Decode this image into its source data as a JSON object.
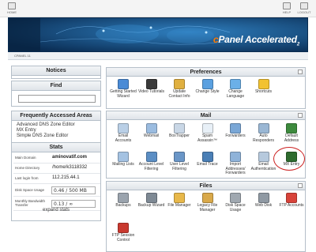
{
  "topbar": {
    "home": "HOME",
    "help": "HELP",
    "logout": "LOGOUT"
  },
  "banner": {
    "brand_prefix": "c",
    "brand_rest": "Panel Accelerated",
    "brand_sub": "2"
  },
  "breadcrumb": "CPANEL 11",
  "left": {
    "notices_title": "Notices",
    "find_title": "Find",
    "faa_title": "Frequently Accessed Areas",
    "faa_links": [
      "Advanced DNS Zone Editor",
      "MX Entry",
      "Simple DNS Zone Editor"
    ],
    "stats_title": "Stats",
    "stats": {
      "main_domain_label": "Main Domain",
      "main_domain_value": "aminovatif.com",
      "home_dir_label": "Home Directory",
      "home_dir_value": "/home/k3118332",
      "last_login_label": "Last login from",
      "last_login_value": "112.215.44.1",
      "disk_label": "Disk Space Usage",
      "disk_value": "0.46 / 500 MB",
      "bandwidth_label": "Monthly Bandwidth Transfer",
      "bandwidth_value": "0.13 / ∞"
    },
    "expand_stats": "expand stats"
  },
  "panels": {
    "preferences_title": "Preferences",
    "mail_title": "Mail",
    "files_title": "Files"
  },
  "preferences": [
    {
      "label": "Getting Started Wizard",
      "icon": "wizard-icon",
      "color": "#4a8bd6"
    },
    {
      "label": "Video Tutorials",
      "icon": "video-icon",
      "color": "#3a3a3a"
    },
    {
      "label": "Update Contact Info",
      "icon": "contact-icon",
      "color": "#e0b040"
    },
    {
      "label": "Change Style",
      "icon": "style-icon",
      "color": "#5aa0e0"
    },
    {
      "label": "Change Language",
      "icon": "language-icon",
      "color": "#6bb0e8"
    },
    {
      "label": "Shortcuts",
      "icon": "star-icon",
      "color": "#f2c230"
    }
  ],
  "mail": [
    {
      "label": "Email Accounts",
      "icon": "envelope-icon",
      "color": "#b9cfe6"
    },
    {
      "label": "Webmail",
      "icon": "webmail-icon",
      "color": "#9bbce0"
    },
    {
      "label": "BoxTrapper",
      "icon": "boxtrapper-icon",
      "color": "#c9d7e6"
    },
    {
      "label": "Spam Assassin™",
      "icon": "spamassassin-icon",
      "color": "#e8f0f7"
    },
    {
      "label": "Forwarders",
      "icon": "forwarders-icon",
      "color": "#7aa7d6"
    },
    {
      "label": "Auto Responders",
      "icon": "autoresponder-icon",
      "color": "#9ab7d4"
    },
    {
      "label": "Default Address",
      "icon": "default-address-icon",
      "color": "#3d8a3d"
    },
    {
      "label": "Mailing Lists",
      "icon": "mailing-lists-icon",
      "color": "#a4c2e2"
    },
    {
      "label": "Account Level Filtering",
      "icon": "filter-icon",
      "color": "#5b8ec4"
    },
    {
      "label": "User Level Filtering",
      "icon": "user-filter-icon",
      "color": "#6a96c7"
    },
    {
      "label": "Email Trace",
      "icon": "trace-icon",
      "color": "#4a7fb6"
    },
    {
      "label": "Import Addresses/ Forwarders",
      "icon": "import-icon",
      "color": "#8fb3d9"
    },
    {
      "label": "Email Authentication",
      "icon": "authentication-icon",
      "color": "#b6c9dd"
    },
    {
      "label": "MX Entry",
      "icon": "mx-entry-icon",
      "color": "#2e6b2e"
    }
  ],
  "files": [
    {
      "label": "Backups",
      "icon": "backups-icon",
      "color": "#9aa3ad"
    },
    {
      "label": "Backup Wizard",
      "icon": "backup-wizard-icon",
      "color": "#7e8994"
    },
    {
      "label": "File Manager",
      "icon": "file-manager-icon",
      "color": "#e8b84a"
    },
    {
      "label": "Legacy File Manager",
      "icon": "legacy-file-manager-icon",
      "color": "#d9a94a"
    },
    {
      "label": "Disk Space Usage",
      "icon": "disk-icon",
      "color": "#a0a8b0"
    },
    {
      "label": "Web Disk",
      "icon": "web-disk-icon",
      "color": "#8f99a3"
    },
    {
      "label": "FTP Accounts",
      "icon": "ftp-accounts-icon",
      "color": "#d8433a"
    },
    {
      "label": "FTP Session Control",
      "icon": "ftp-session-icon",
      "color": "#c9392f"
    }
  ]
}
